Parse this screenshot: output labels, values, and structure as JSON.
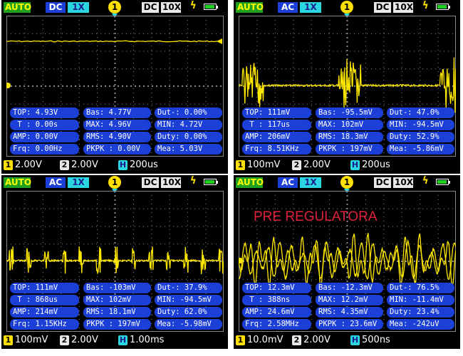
{
  "colors": {
    "trace": "#ffe800",
    "grid": "#8a8a8a",
    "measure_bg": "#1c3fd8",
    "auto": "#1fa01f",
    "annotation": "#e0203c"
  },
  "icons": [
    "trigger-badge-icon",
    "trigger-position-marker-icon",
    "bolt-icon",
    "battery-icon",
    "channel-1-icon",
    "channel-2-icon",
    "horizontal-icon"
  ],
  "panels": [
    {
      "header": {
        "mode": "AUTO",
        "coupling": "DC",
        "probe": "1X",
        "trigger_channel": "1",
        "ch2_coupling": "DC",
        "ch2_probe": "10X"
      },
      "annotation": "",
      "measurements": {
        "top": "TOP: 4.93V",
        "bas": "Bas: 4.77V",
        "dutm": "Dut-: 0.00%",
        "t": " T : 0.00s",
        "max": "MAX: 4.96V",
        "min": "MIN: 4.72V",
        "amp": "AMP: 0.00V",
        "rms": "RMS: 4.90V",
        "duty": "Duty: 0.00%",
        "frq": "Frq: 0.00Hz",
        "pkpk": "PKPK : 0.00V",
        "mea": "Mea: 5.03V"
      },
      "footer": {
        "ch1_label": "1",
        "ch1_scale": "2.00V",
        "ch2_label": "2",
        "ch2_scale": "2.00V",
        "h_label": "H",
        "timebase": "200us"
      }
    },
    {
      "header": {
        "mode": "AUTO",
        "coupling": "AC",
        "probe": "1X",
        "trigger_channel": "1",
        "ch2_coupling": "DC",
        "ch2_probe": "10X"
      },
      "annotation": "",
      "measurements": {
        "top": "TOP: 111mV",
        "bas": "Bas: -95.5mV",
        "dutm": "Dut-: 47.0%",
        "t": " T : 117us",
        "max": "MAX: 102mV",
        "min": "MIN: -94.5mV",
        "amp": "AMP: 206mV",
        "rms": "RMS: 18.3mV",
        "duty": "Duty: 52.9%",
        "frq": "Frq: 8.51KHz",
        "pkpk": "PKPK : 197mV",
        "mea": "Mea: -5.86mV"
      },
      "footer": {
        "ch1_label": "1",
        "ch1_scale": "100mV",
        "ch2_label": "2",
        "ch2_scale": "2.00V",
        "h_label": "H",
        "timebase": "200us"
      }
    },
    {
      "header": {
        "mode": "AUTO",
        "coupling": "AC",
        "probe": "1X",
        "trigger_channel": "1",
        "ch2_coupling": "DC",
        "ch2_probe": "10X"
      },
      "annotation": "",
      "measurements": {
        "top": "TOP: 111mV",
        "bas": "Bas: -103mV",
        "dutm": "Dut-: 37.9%",
        "t": " T : 868us",
        "max": "MAX: 102mV",
        "min": "MIN: -94.5mV",
        "amp": "AMP: 214mV",
        "rms": "RMS: 18.1mV",
        "duty": "Duty: 62.0%",
        "frq": "Frq: 1.15KHz",
        "pkpk": "PKPK : 197mV",
        "mea": "Mea: -5.98mV"
      },
      "footer": {
        "ch1_label": "1",
        "ch1_scale": "100mV",
        "ch2_label": "2",
        "ch2_scale": "2.00V",
        "h_label": "H",
        "timebase": "1.00ms"
      }
    },
    {
      "header": {
        "mode": "AUTO",
        "coupling": "AC",
        "probe": "1X",
        "trigger_channel": "1",
        "ch2_coupling": "DC",
        "ch2_probe": "10X"
      },
      "annotation": "PRE REGULATORA",
      "measurements": {
        "top": "TOP: 12.3mV",
        "bas": "Bas: -12.3mV",
        "dutm": "Dut-: 76.5%",
        "t": " T : 388ns",
        "max": "MAX: 12.2mV",
        "min": "MIN: -11.4mV",
        "amp": "AMP: 24.6mV",
        "rms": "RMS: 4.35mV",
        "duty": "Duty: 23.4%",
        "frq": "Frq: 2.58MHz",
        "pkpk": "PKPK : 23.6mV",
        "mea": "Mea: -242uV"
      },
      "footer": {
        "ch1_label": "1",
        "ch1_scale": "10.0mV",
        "ch2_label": "2",
        "ch2_scale": "2.00V",
        "h_label": "H",
        "timebase": "500ns"
      }
    }
  ]
}
